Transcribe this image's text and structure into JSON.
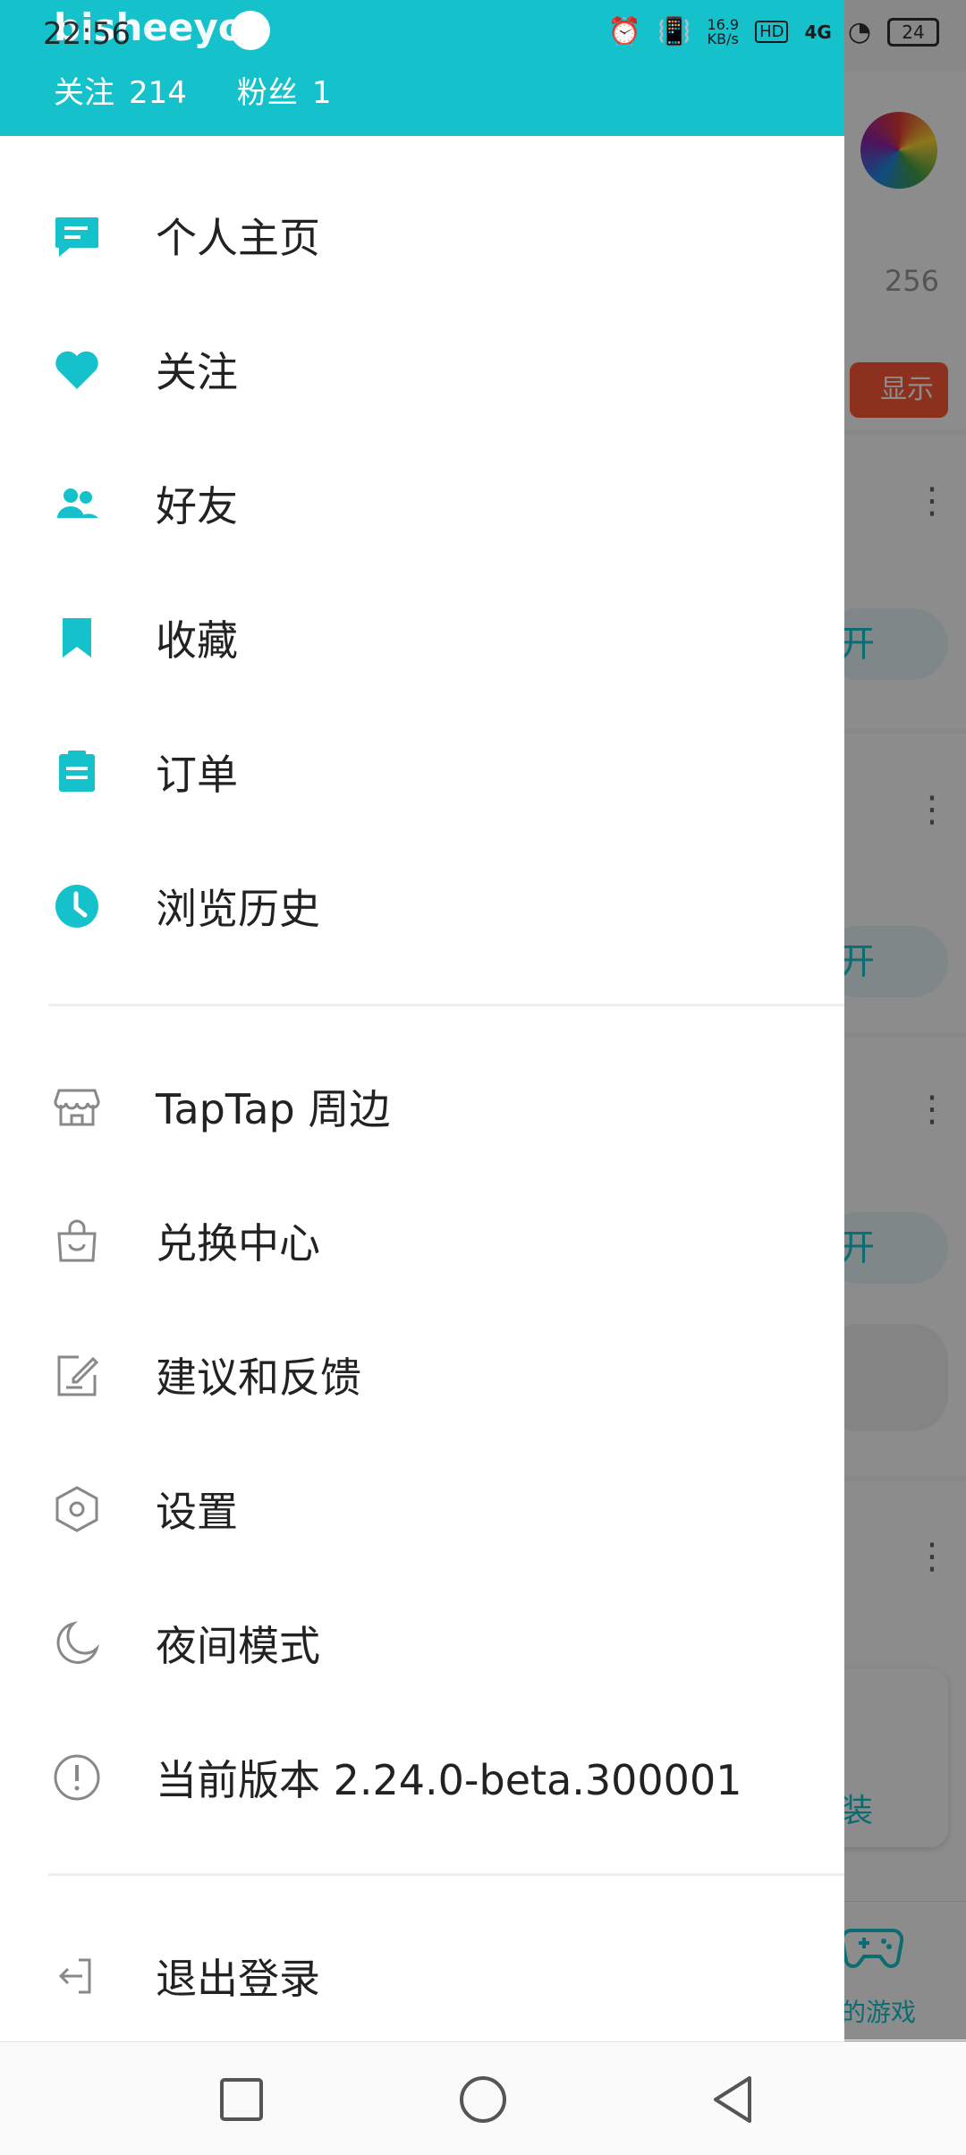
{
  "status_bar": {
    "time": "22:56",
    "net_speed_value": "16.9",
    "net_speed_unit": "KB/s",
    "hd": "HD",
    "network": "4G",
    "battery": "24"
  },
  "drawer": {
    "username": "bisheeyo",
    "follow_label": "关注",
    "follow_count": "214",
    "fans_label": "粉丝",
    "fans_count": "1",
    "menu_primary": [
      {
        "label": "个人主页",
        "icon": "profile-card-icon"
      },
      {
        "label": "关注",
        "icon": "heart-icon"
      },
      {
        "label": "好友",
        "icon": "friends-icon"
      },
      {
        "label": "收藏",
        "icon": "bookmark-icon"
      },
      {
        "label": "订单",
        "icon": "order-clipboard-icon"
      },
      {
        "label": "浏览历史",
        "icon": "clock-icon"
      }
    ],
    "menu_secondary": [
      {
        "label": "TapTap  周边",
        "icon": "store-icon"
      },
      {
        "label": "兑换中心",
        "icon": "shopping-bag-icon"
      },
      {
        "label": "建议和反馈",
        "icon": "edit-feedback-icon"
      },
      {
        "label": "设置",
        "icon": "settings-hexagon-icon"
      },
      {
        "label": "夜间模式",
        "icon": "moon-icon"
      },
      {
        "label": "当前版本  2.24.0-beta.300001",
        "icon": "info-exclamation-icon"
      }
    ],
    "logout_label": "退出登录"
  },
  "background": {
    "count": "256",
    "badge": "显示",
    "btn_a": "开",
    "btn_b": "开",
    "btn_c": "开",
    "install": "装",
    "tab_label": "的游戏"
  },
  "colors": {
    "accent": "#15c1cb",
    "icon_gray": "#888888"
  }
}
